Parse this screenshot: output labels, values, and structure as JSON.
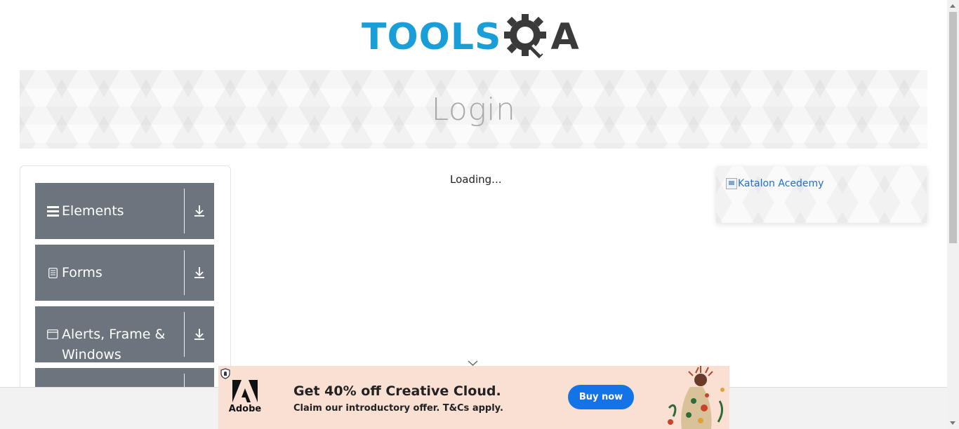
{
  "header": {
    "logo_text_primary": "TOOLS",
    "logo_text_secondary": "A",
    "logo_color_primary": "#1a9ed8",
    "logo_color_secondary": "#3a3a3a"
  },
  "banner": {
    "title": "Login"
  },
  "sidebar": {
    "groups": [
      {
        "label": "Elements",
        "icon": "hamburger-icon"
      },
      {
        "label": "Forms",
        "icon": "document-icon"
      },
      {
        "label": "Alerts, Frame & Windows",
        "icon": "window-icon"
      },
      {
        "label": "",
        "icon": ""
      }
    ],
    "group_color": "#6c757d"
  },
  "main": {
    "loading_text": "Loading..."
  },
  "right_ad": {
    "alt_text": "Katalon Acedemy"
  },
  "bottom_ad": {
    "brand": "Adobe",
    "headline": "Get 40% off Creative Cloud.",
    "subtext": "Claim our introductory offer. T&Cs apply.",
    "cta": "Buy now",
    "cta_color": "#1473e6",
    "background": "#fadfd3"
  }
}
